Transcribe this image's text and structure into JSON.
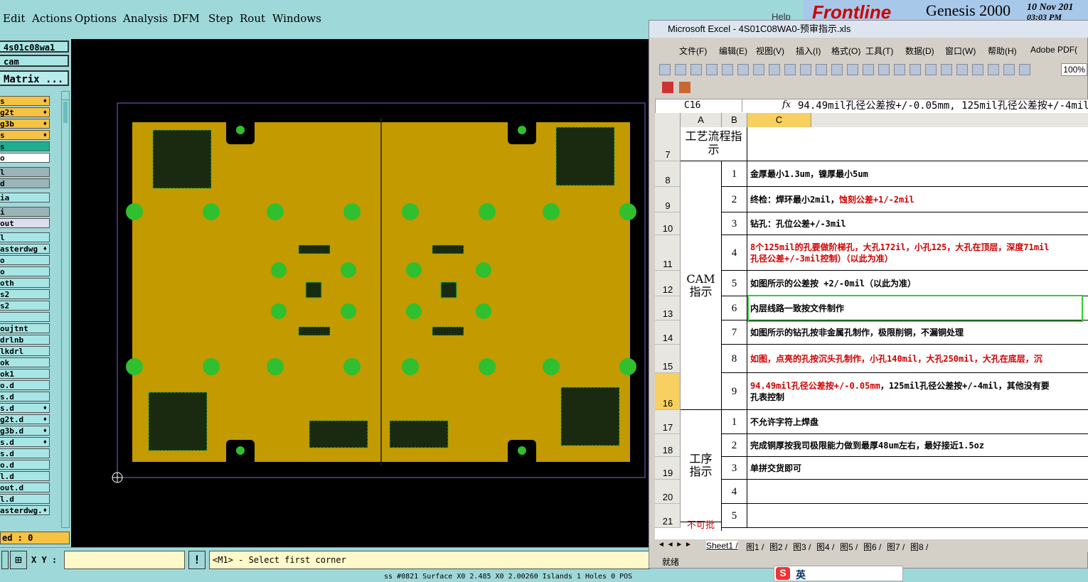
{
  "genesis": {
    "menu": [
      "Edit",
      "Actions",
      "Options",
      "Analysis",
      "DFM",
      "Step",
      "Rout",
      "Windows"
    ],
    "help": "Help",
    "job": "4s01c08wa1",
    "step": "cam",
    "matrix_btn": "Matrix ...",
    "layers": [
      {
        "t": "s",
        "c": "#f5c242",
        "m": "♦"
      },
      {
        "t": "g2t",
        "c": "#f5c242",
        "m": "♦"
      },
      {
        "t": "g3b",
        "c": "#f5c242",
        "m": "♦"
      },
      {
        "t": "s",
        "c": "#f5c242",
        "m": "♦"
      },
      {
        "t": "s",
        "c": "#1fae8f",
        "m": ""
      },
      {
        "t": "o",
        "c": "#ffffff",
        "m": ""
      },
      {
        "t": "l",
        "c": "#9ab4b8",
        "m": ""
      },
      {
        "t": "d",
        "c": "#9ab4b8",
        "m": ""
      },
      {
        "t": "ia",
        "c": "#a8e6e6",
        "m": ""
      },
      {
        "t": "i",
        "c": "#9ab4b8",
        "m": ""
      },
      {
        "t": "out",
        "c": "#dde",
        "m": ""
      },
      {
        "t": "l",
        "c": "#a8e6e6",
        "m": ""
      },
      {
        "t": "asterdwg",
        "c": "#a8e6e6",
        "m": "♦"
      },
      {
        "t": "o",
        "c": "#a8e6e6",
        "m": ""
      },
      {
        "t": "o",
        "c": "#a8e6e6",
        "m": ""
      },
      {
        "t": "oth",
        "c": "#a8e6e6",
        "m": ""
      },
      {
        "t": "s2",
        "c": "#a8e6e6",
        "m": ""
      },
      {
        "t": "s2",
        "c": "#a8e6e6",
        "m": ""
      },
      {
        "t": "",
        "c": "#a8e6e6",
        "m": ""
      },
      {
        "t": "oujtnt",
        "c": "#a8e6e6",
        "m": ""
      },
      {
        "t": "drlnb",
        "c": "#a8e6e6",
        "m": ""
      },
      {
        "t": "lkdrl",
        "c": "#a8e6e6",
        "m": ""
      },
      {
        "t": "ok",
        "c": "#a8e6e6",
        "m": ""
      },
      {
        "t": "ok1",
        "c": "#a8e6e6",
        "m": ""
      },
      {
        "t": "o.d",
        "c": "#a8e6e6",
        "m": ""
      },
      {
        "t": "s.d",
        "c": "#a8e6e6",
        "m": ""
      },
      {
        "t": "s.d",
        "c": "#a8e6e6",
        "m": "♦"
      },
      {
        "t": "g2t.d",
        "c": "#a8e6e6",
        "m": "♦"
      },
      {
        "t": "g3b.d",
        "c": "#a8e6e6",
        "m": "♦"
      },
      {
        "t": "s.d",
        "c": "#a8e6e6",
        "m": "♦"
      },
      {
        "t": "s.d",
        "c": "#a8e6e6",
        "m": ""
      },
      {
        "t": "o.d",
        "c": "#a8e6e6",
        "m": ""
      },
      {
        "t": "l.d",
        "c": "#a8e6e6",
        "m": ""
      },
      {
        "t": "out.d",
        "c": "#a8e6e6",
        "m": ""
      },
      {
        "t": "l.d",
        "c": "#a8e6e6",
        "m": ""
      },
      {
        "t": "asterdwg.",
        "c": "#a8e6e6",
        "m": "♦"
      }
    ],
    "selected": "ed : 0",
    "xy_label": "X Y :",
    "prompt": "<M1> - Select first corner",
    "status": "ss #0821 Surface X0 2.485 X0 2.00260 Islands 1 Holes 0 POS"
  },
  "brand": {
    "logo": "Frontline",
    "product": "Genesis 2000",
    "date": "10 Nov 201",
    "time": "03:03 PM"
  },
  "excel": {
    "title": "Microsoft Excel - 4S01C08WA0-预审指示.xls",
    "menu": [
      "文件(F)",
      "编辑(E)",
      "视图(V)",
      "插入(I)",
      "格式(O)",
      "工具(T)",
      "数据(D)",
      "窗口(W)",
      "帮助(H)",
      "Adobe PDF("
    ],
    "zoom": "100%",
    "cell": "C16",
    "formula": "94.49mil孔径公差按+/-0.05mm, 125mil孔径公差按+/-4mil\n制",
    "cols": [
      "A",
      "B",
      "C"
    ],
    "rows": [
      {
        "n": "7",
        "h": 48
      },
      {
        "n": "8",
        "h": 36
      },
      {
        "n": "9",
        "h": 36
      },
      {
        "n": "10",
        "h": 32
      },
      {
        "n": "11",
        "h": 50
      },
      {
        "n": "12",
        "h": 36
      },
      {
        "n": "13",
        "h": 34
      },
      {
        "n": "14",
        "h": 34
      },
      {
        "n": "15",
        "h": 40
      },
      {
        "n": "16",
        "h": 52
      },
      {
        "n": "17",
        "h": 34
      },
      {
        "n": "18",
        "h": 32
      },
      {
        "n": "19",
        "h": 32
      },
      {
        "n": "20",
        "h": 34
      },
      {
        "n": "21",
        "h": 34
      }
    ],
    "header7": "工艺流程指示",
    "group_cam": "CAM\n指示",
    "group_proc": "工序\n指示",
    "group_last": "不可批",
    "items": [
      {
        "n": "1",
        "parts": [
          {
            "t": "金厚最小1.3um，镍厚最小5um",
            "r": 0
          }
        ]
      },
      {
        "n": "2",
        "parts": [
          {
            "t": "终检：焊环最小2mil，",
            "r": 0
          },
          {
            "t": "蚀刻公差+1/-2mil",
            "r": 1
          }
        ]
      },
      {
        "n": "3",
        "parts": [
          {
            "t": "钻孔：孔位公差+/-3mil",
            "r": 0
          }
        ]
      },
      {
        "n": "4",
        "parts": [
          {
            "t": "8个125mil的孔要做阶梯孔，大孔172il，小孔125，大孔在顶层，深度71mil\n孔径公差+/-3mil控制）（以此为准）",
            "r": 1
          }
        ]
      },
      {
        "n": "5",
        "parts": [
          {
            "t": "如图所示的公差按 +2/-0mil（以此为准）",
            "r": 0
          }
        ]
      },
      {
        "n": "6",
        "parts": [
          {
            "t": "内层线路一致按文件制作",
            "r": 0
          }
        ]
      },
      {
        "n": "7",
        "parts": [
          {
            "t": "如图所示的钻孔按非金属孔制作，极限削铜，不漏铜处理",
            "r": 0
          }
        ]
      },
      {
        "n": "8",
        "parts": [
          {
            "t": "如图，点亮的孔按沉头孔制作，小孔140mil，大孔250mil，大孔在底层，沉",
            "r": 1
          }
        ]
      },
      {
        "n": "9",
        "parts": [
          {
            "t": "94.49mil孔径公差按+/-0.05mm",
            "r": 1
          },
          {
            "t": "，125mil孔径公差按+/-4mil，其他没有要\n孔表控制",
            "r": 0
          }
        ]
      },
      {
        "n": "1",
        "parts": [
          {
            "t": "不允许字符上焊盘",
            "r": 0
          }
        ]
      },
      {
        "n": "2",
        "parts": [
          {
            "t": "完成铜厚按我司极限能力做到最厚48um左右，最好接近1.5oz",
            "r": 0
          }
        ]
      },
      {
        "n": "3",
        "parts": [
          {
            "t": "单拼交货即可",
            "r": 0
          }
        ]
      },
      {
        "n": "4",
        "parts": [
          {
            "t": "",
            "r": 0
          }
        ]
      },
      {
        "n": "5",
        "parts": [
          {
            "t": "",
            "r": 0
          }
        ]
      }
    ],
    "sheets": [
      "Sheet1",
      "图1",
      "图2",
      "图3",
      "图4",
      "图5",
      "图6",
      "图7",
      "图8"
    ],
    "status": "就绪"
  },
  "ime": {
    "label": "英"
  }
}
